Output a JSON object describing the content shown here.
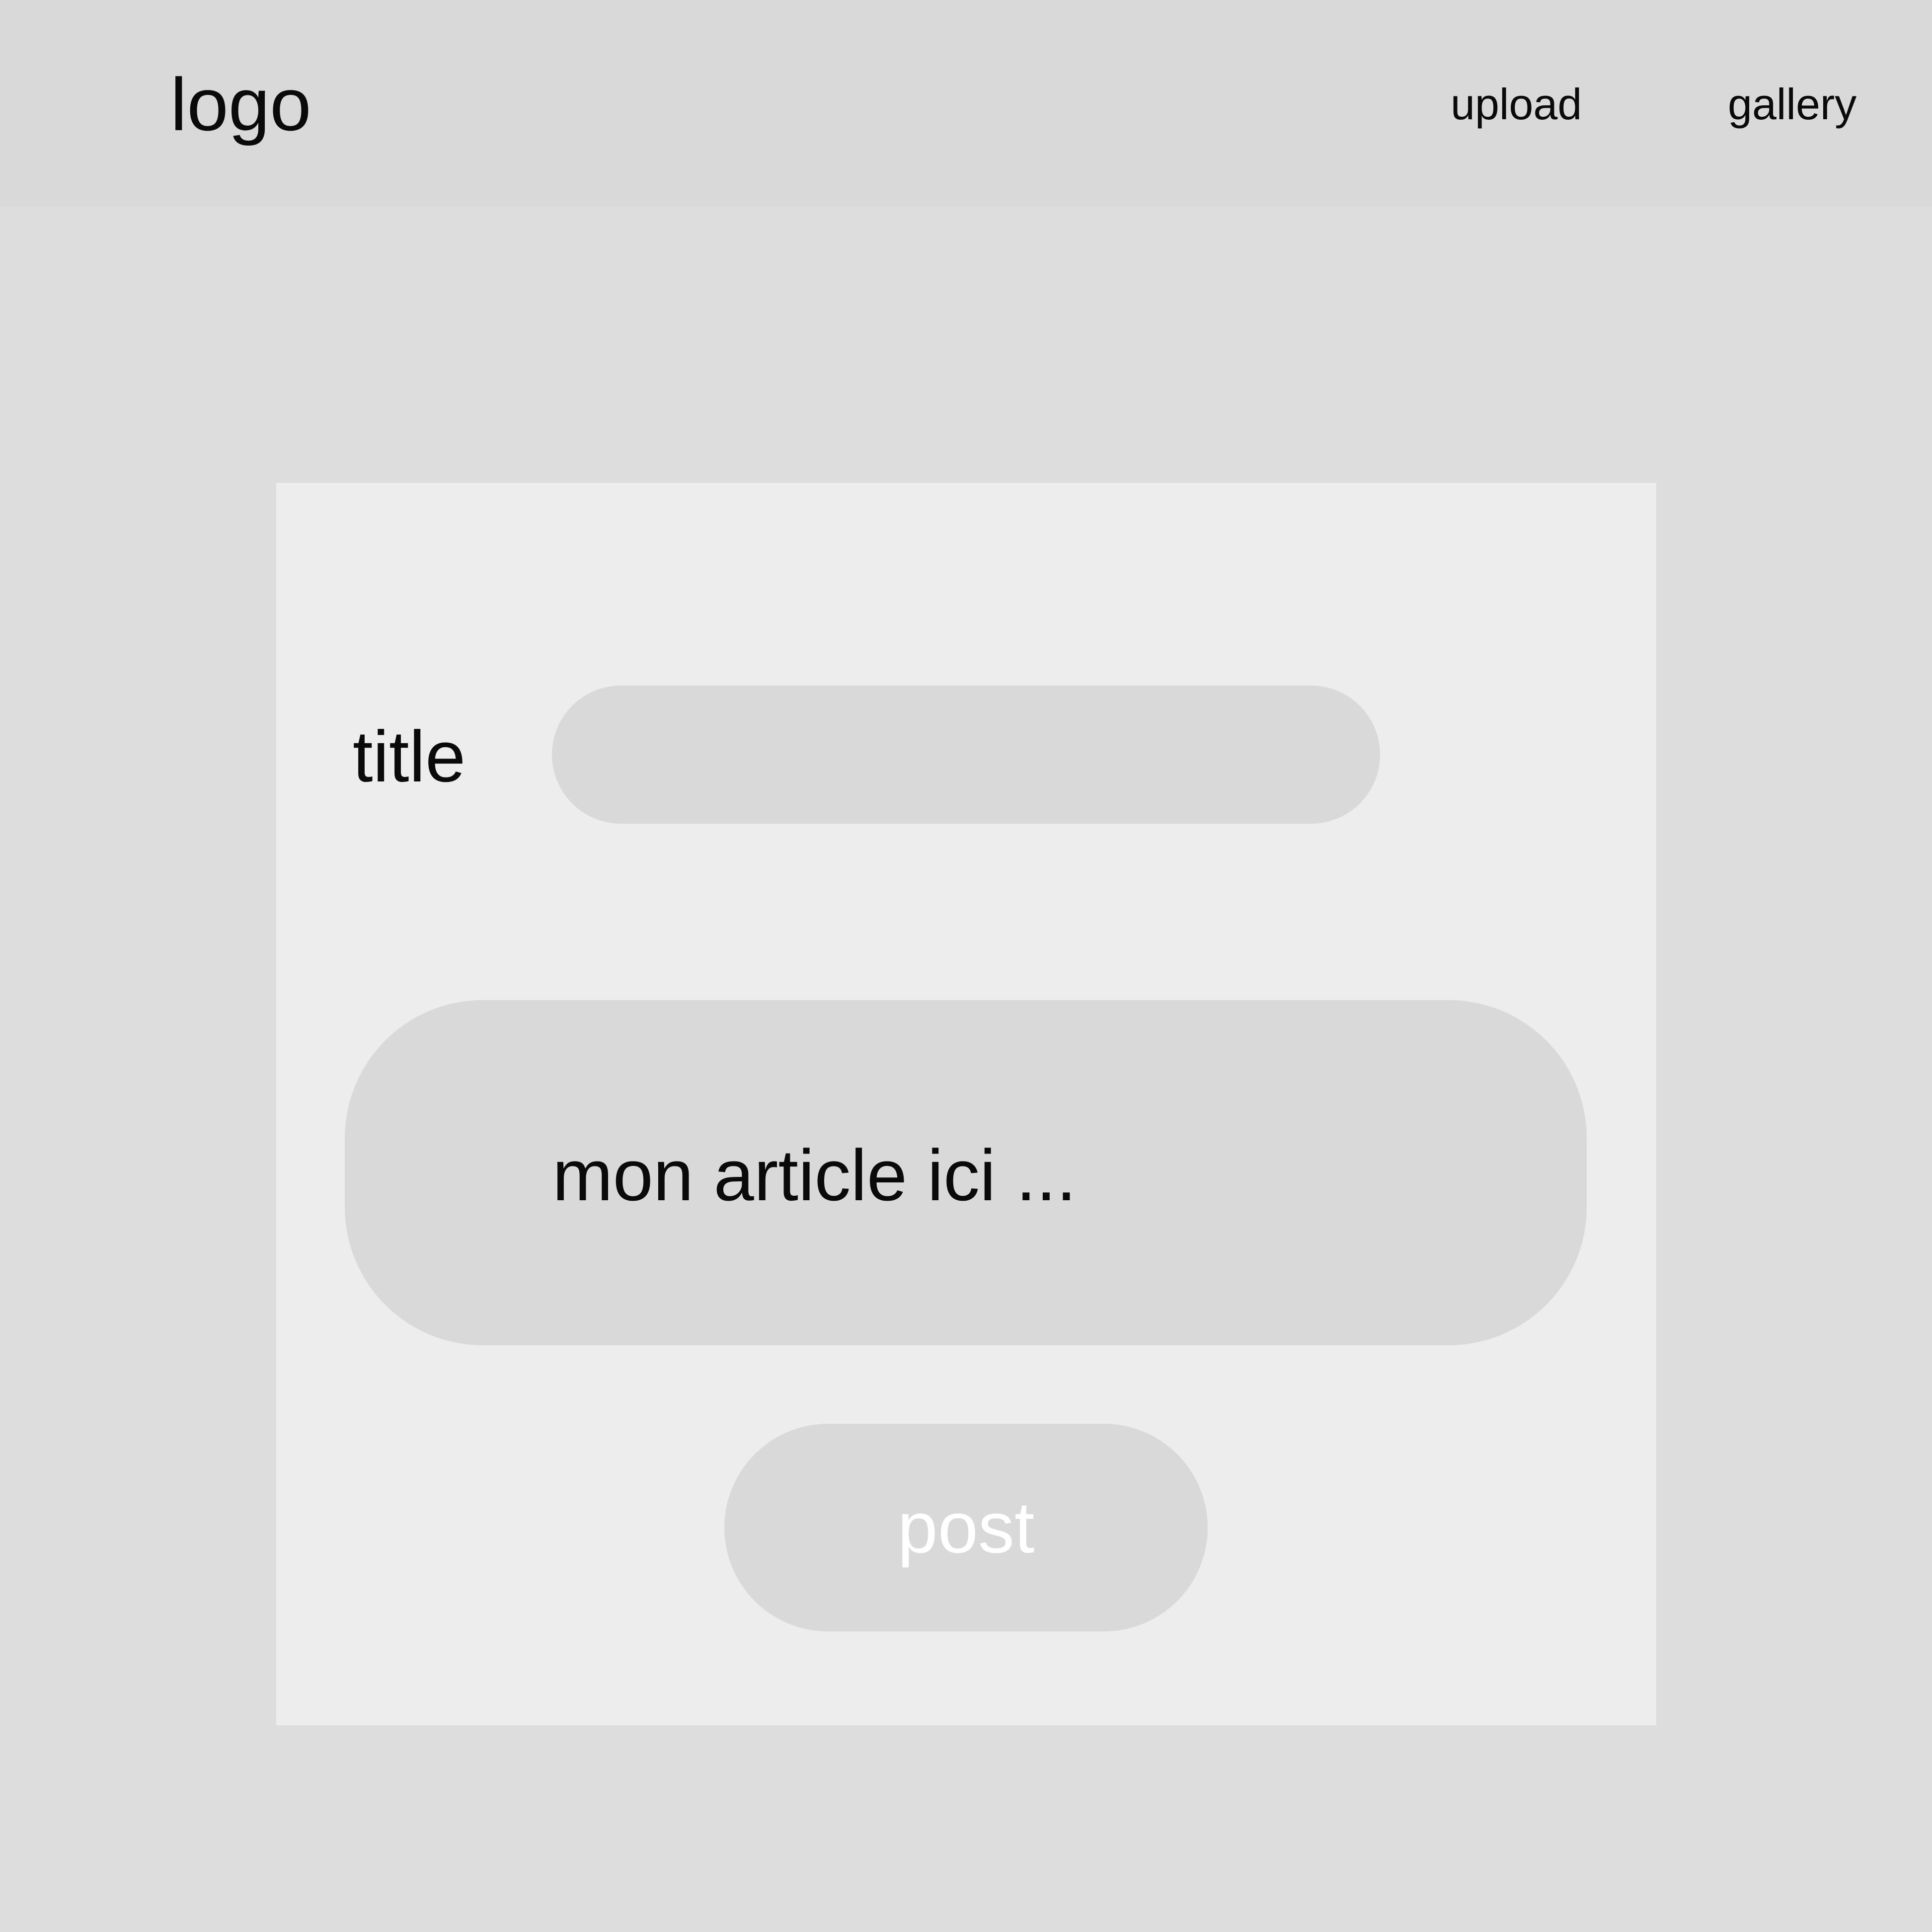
{
  "header": {
    "logo_text": "logo",
    "nav": {
      "upload_label": "upload",
      "gallery_label": "gallery"
    }
  },
  "form": {
    "title_label": "title",
    "title_value": "",
    "article_placeholder": "mon article ici ...",
    "post_label": "post"
  },
  "colors": {
    "header_background": "#d9d9d9",
    "page_background": "#dddddd",
    "panel_background": "#ededed",
    "field_background": "#d9d9d9",
    "text": "#0a0a0a",
    "button_text": "#ffffff"
  }
}
